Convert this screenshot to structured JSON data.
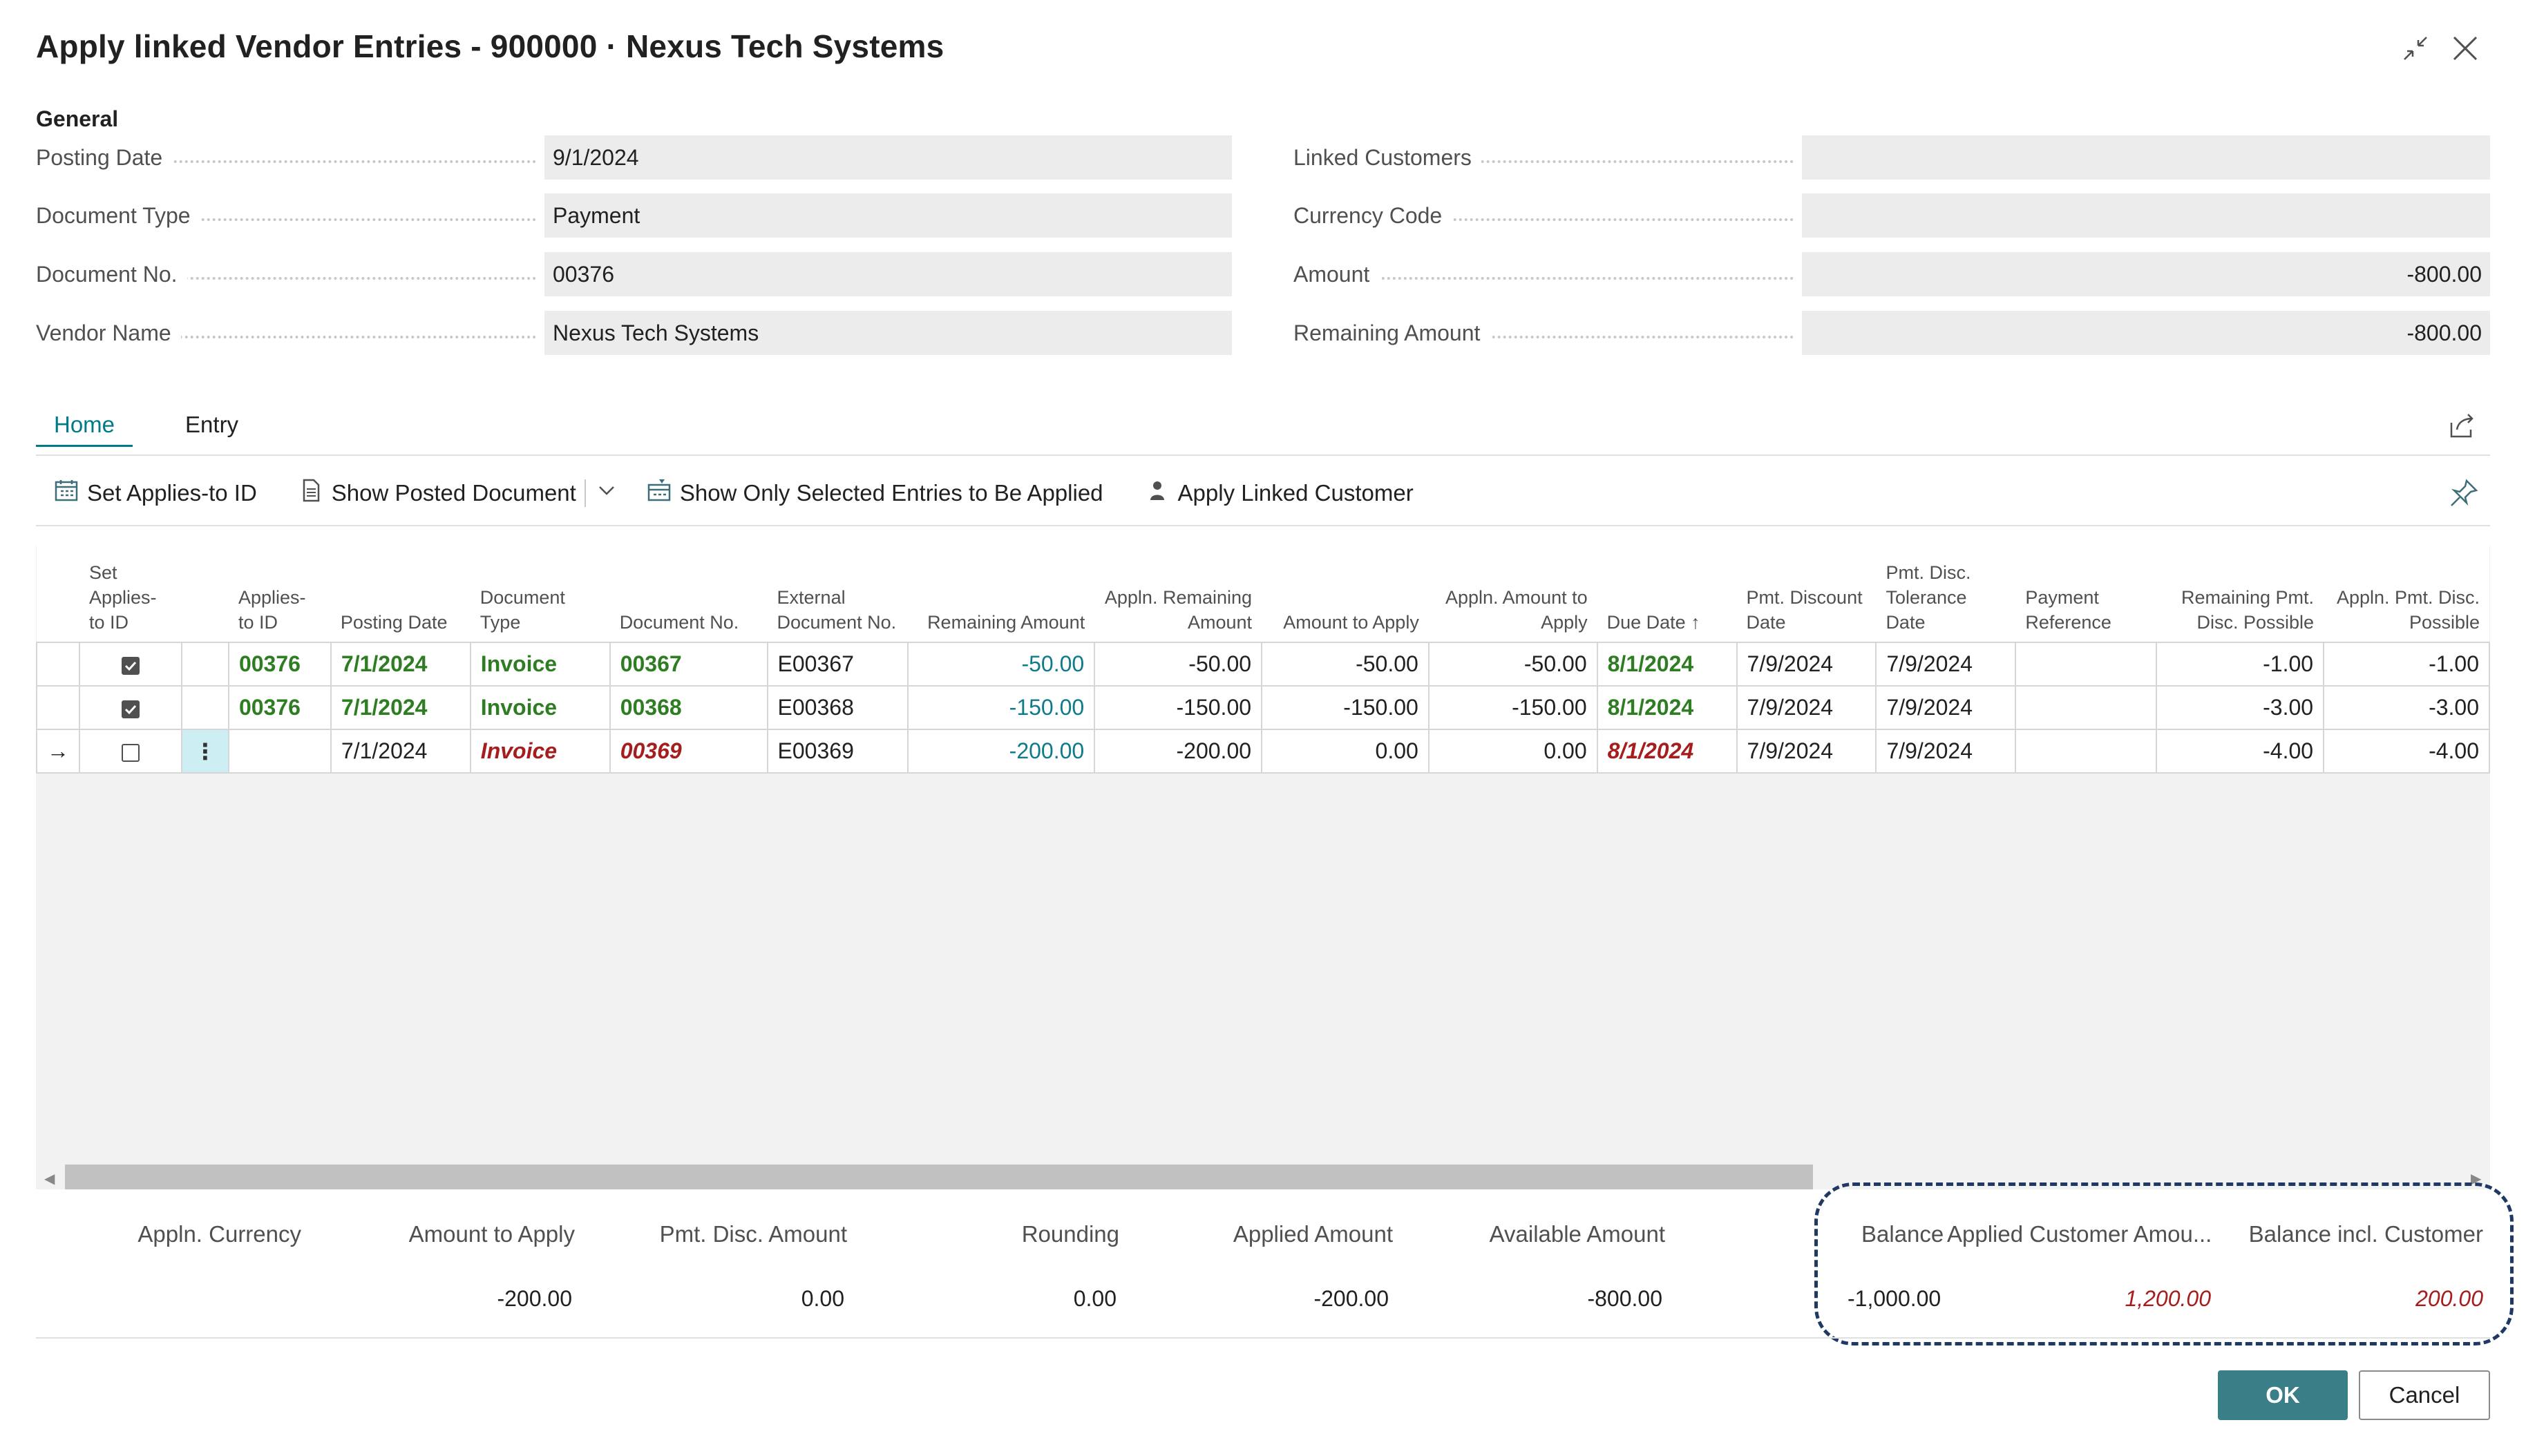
{
  "window": {
    "title": "Apply linked Vendor Entries - 900000 · Nexus Tech Systems"
  },
  "general": {
    "caption": "General",
    "left_fields": [
      {
        "label": "Posting Date",
        "value": "9/1/2024"
      },
      {
        "label": "Document Type",
        "value": "Payment"
      },
      {
        "label": "Document No.",
        "value": "00376"
      },
      {
        "label": "Vendor Name",
        "value": "Nexus Tech Systems"
      }
    ],
    "right_fields": [
      {
        "label": "Linked Customers",
        "value": ""
      },
      {
        "label": "Currency Code",
        "value": ""
      },
      {
        "label": "Amount",
        "value": "-800.00"
      },
      {
        "label": "Remaining Amount",
        "value": "-800.00"
      }
    ]
  },
  "tabs": [
    {
      "label": "Home",
      "active": true
    },
    {
      "label": "Entry",
      "active": false
    }
  ],
  "toolbar": {
    "set_applies_to_id": "Set Applies-to ID",
    "show_posted_document": "Show Posted Document",
    "show_only_selected": "Show Only Selected Entries to Be Applied",
    "apply_linked_customer": "Apply Linked Customer"
  },
  "grid": {
    "columns": [
      "Set Applies-to ID",
      "Applies-to ID",
      "Posting Date",
      "Document Type",
      "Document No.",
      "External Document No.",
      "Remaining Amount",
      "Appln. Remaining Amount",
      "Amount to Apply",
      "Appln. Amount to Apply",
      "Due Date",
      "Pmt. Discount Date",
      "Pmt. Disc. Tolerance Date",
      "Payment Reference",
      "Remaining Pmt. Disc. Possible",
      "Appln. Pmt. Disc. Possible"
    ],
    "rows": [
      {
        "checked": true,
        "applies_to_id": "00376",
        "posting_date": "7/1/2024",
        "doc_type": "Invoice",
        "doc_no": "00367",
        "ext_doc_no": "E00367",
        "remaining": "-50.00",
        "appln_remaining": "-50.00",
        "amount_to_apply": "-50.00",
        "appln_amount_to_apply": "-50.00",
        "due_date": "8/1/2024",
        "pmt_disc_date": "7/9/2024",
        "pmt_disc_tol_date": "7/9/2024",
        "payment_ref": "",
        "rem_pmt_disc": "-1.00",
        "appln_pmt_disc": "-1.00",
        "style": "green"
      },
      {
        "checked": true,
        "applies_to_id": "00376",
        "posting_date": "7/1/2024",
        "doc_type": "Invoice",
        "doc_no": "00368",
        "ext_doc_no": "E00368",
        "remaining": "-150.00",
        "appln_remaining": "-150.00",
        "amount_to_apply": "-150.00",
        "appln_amount_to_apply": "-150.00",
        "due_date": "8/1/2024",
        "pmt_disc_date": "7/9/2024",
        "pmt_disc_tol_date": "7/9/2024",
        "payment_ref": "",
        "rem_pmt_disc": "-3.00",
        "appln_pmt_disc": "-3.00",
        "style": "green"
      },
      {
        "checked": false,
        "applies_to_id": "",
        "posting_date": "7/1/2024",
        "doc_type": "Invoice",
        "doc_no": "00369",
        "ext_doc_no": "E00369",
        "remaining": "-200.00",
        "appln_remaining": "-200.00",
        "amount_to_apply": "0.00",
        "appln_amount_to_apply": "0.00",
        "due_date": "8/1/2024",
        "pmt_disc_date": "7/9/2024",
        "pmt_disc_tol_date": "7/9/2024",
        "payment_ref": "",
        "rem_pmt_disc": "-4.00",
        "appln_pmt_disc": "-4.00",
        "style": "red"
      }
    ]
  },
  "totals": {
    "items": [
      {
        "label": "Appln. Currency",
        "value": ""
      },
      {
        "label": "Amount to Apply",
        "value": "-200.00"
      },
      {
        "label": "Pmt. Disc. Amount",
        "value": "0.00"
      },
      {
        "label": "Rounding",
        "value": "0.00"
      },
      {
        "label": "Applied Amount",
        "value": "-200.00"
      },
      {
        "label": "Available Amount",
        "value": "-800.00"
      },
      {
        "label": "Balance",
        "value": "-1,000.00"
      },
      {
        "label": "Applied Customer Amou...",
        "value": "1,200.00"
      },
      {
        "label": "Balance incl. Customer",
        "value": "200.00"
      }
    ]
  },
  "buttons": {
    "ok": "OK",
    "cancel": "Cancel"
  },
  "colors": {
    "accent": "#007a87",
    "ok_button": "#3a7f88",
    "green_text": "#2e7d22",
    "red_text": "#a51d1d",
    "highlight_border": "#1f3864"
  }
}
